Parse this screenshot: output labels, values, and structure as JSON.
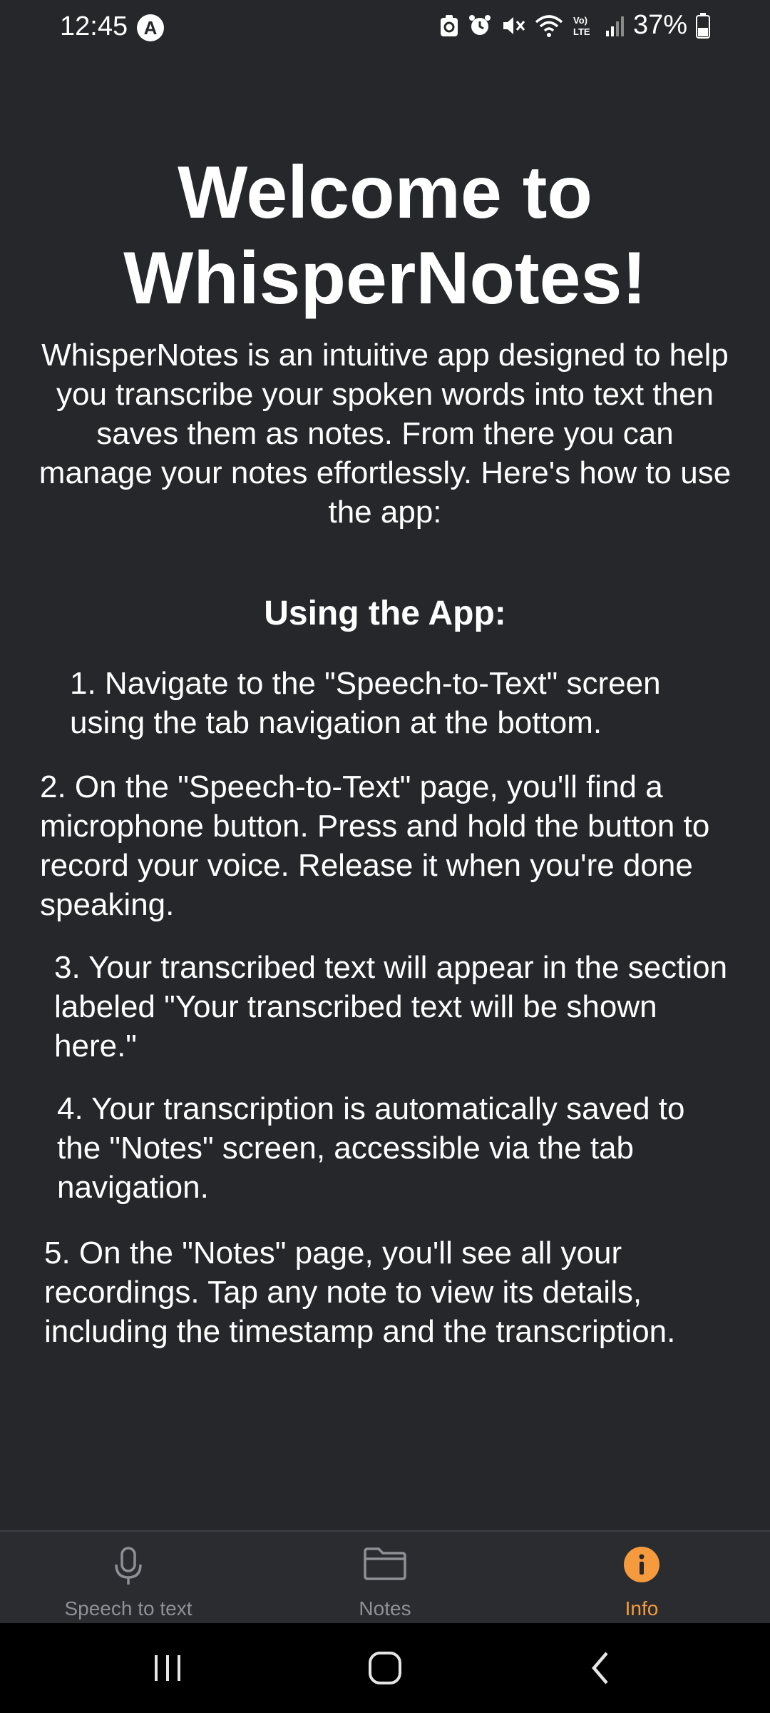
{
  "status_bar": {
    "time": "12:45",
    "badge_letter": "A",
    "battery_percent": "37%"
  },
  "welcome": {
    "title_line1": "Welcome to",
    "title_line2": "WhisperNotes!",
    "intro": "WhisperNotes is an intuitive app designed to help you transcribe your spoken words into text then saves them as notes. From there you can manage your notes effortlessly. Here's how to use the app:"
  },
  "section_title": "Using the App:",
  "steps": [
    "1. Navigate to the \"Speech-to-Text\" screen using the tab navigation at the bottom.",
    "2. On the \"Speech-to-Text\" page, you'll find a microphone button. Press and hold the button to record your voice. Release it when you're done speaking.",
    "3. Your transcribed text will appear in the section labeled \"Your transcribed text will be shown here.\"",
    "4. Your transcription is automatically saved to the \"Notes\" screen, accessible via the tab navigation.",
    "5. On the \"Notes\" page, you'll see all your recordings. Tap any note to view its details, including the timestamp and the transcription."
  ],
  "tabs": [
    {
      "label": "Speech to text",
      "icon": "microphone-icon",
      "active": false
    },
    {
      "label": "Notes",
      "icon": "folder-icon",
      "active": false
    },
    {
      "label": "Info",
      "icon": "info-icon",
      "active": true
    }
  ],
  "colors": {
    "background": "#25272b",
    "accent": "#f59a3d",
    "inactive_tab": "#8e9095"
  }
}
